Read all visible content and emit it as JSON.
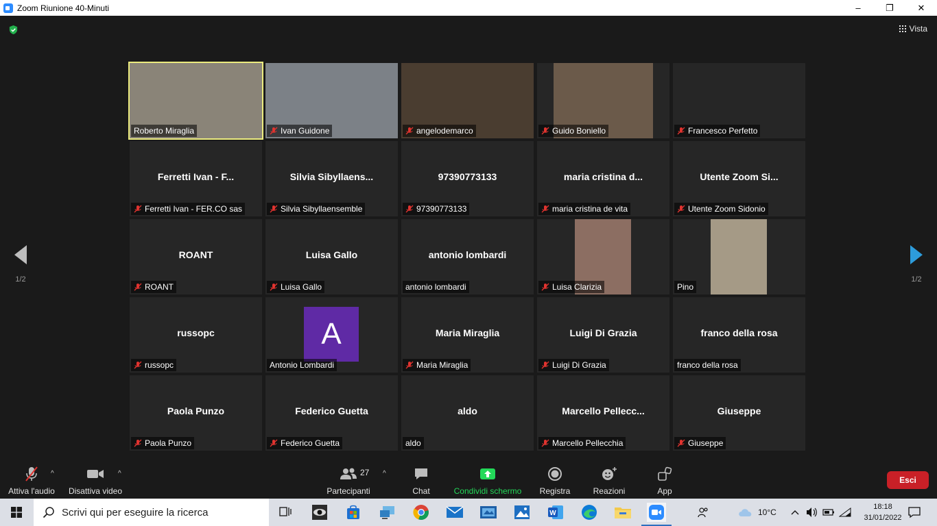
{
  "window": {
    "title": "Zoom Riunione 40-Minuti",
    "controls": {
      "minimize": "–",
      "restore": "❐",
      "close": "✕"
    }
  },
  "header": {
    "view_label": "Vista"
  },
  "pagination": {
    "left_page": "1/2",
    "right_page": "1/2"
  },
  "participants": [
    {
      "big_name": "",
      "label": "Roberto Miraglia",
      "muted": false,
      "video": "full",
      "bg": "#8a8478",
      "active": true
    },
    {
      "big_name": "",
      "label": "Ivan Guidone",
      "muted": true,
      "video": "full",
      "bg": "#7c8187"
    },
    {
      "big_name": "",
      "label": "angelodemarco",
      "muted": true,
      "video": "full",
      "bg": "#4a3d30"
    },
    {
      "big_name": "",
      "label": "Guido Boniello",
      "muted": true,
      "video": "mid",
      "bg": "#6b5a4a"
    },
    {
      "big_name": "",
      "label": "Francesco Perfetto",
      "muted": true,
      "video": "none"
    },
    {
      "big_name": "Ferretti Ivan - F...",
      "label": "Ferretti Ivan - FER.CO sas",
      "muted": true,
      "video": "none"
    },
    {
      "big_name": "Silvia  Sibyllaens...",
      "label": "Silvia Sibyllaensemble",
      "muted": true,
      "video": "none"
    },
    {
      "big_name": "97390773133",
      "label": "97390773133",
      "muted": true,
      "video": "none"
    },
    {
      "big_name": "maria cristina d...",
      "label": "maria cristina de vita",
      "muted": true,
      "video": "none"
    },
    {
      "big_name": "Utente Zoom Si...",
      "label": "Utente Zoom Sidonio",
      "muted": true,
      "video": "none"
    },
    {
      "big_name": "ROANT",
      "label": "ROANT",
      "muted": true,
      "video": "none"
    },
    {
      "big_name": "Luisa Gallo",
      "label": "Luisa Gallo",
      "muted": true,
      "video": "none"
    },
    {
      "big_name": "antonio lombardi",
      "label": "antonio lombardi",
      "muted": false,
      "video": "none"
    },
    {
      "big_name": "",
      "label": "Luisa Clarizia",
      "muted": true,
      "video": "narrow",
      "bg": "#8c6e62"
    },
    {
      "big_name": "",
      "label": "Pino",
      "muted": false,
      "video": "narrow",
      "bg": "#a59a86"
    },
    {
      "big_name": "russopc",
      "label": "russopc",
      "muted": true,
      "video": "none"
    },
    {
      "big_name": "",
      "label": "Antonio Lombardi",
      "muted": false,
      "video": "avatar",
      "avatar_letter": "A"
    },
    {
      "big_name": "Maria Miraglia",
      "label": "Maria Miraglia",
      "muted": true,
      "video": "none"
    },
    {
      "big_name": "Luigi Di Grazia",
      "label": "Luigi Di Grazia",
      "muted": true,
      "video": "none"
    },
    {
      "big_name": "franco  della rosa",
      "label": "franco  della rosa",
      "muted": false,
      "video": "none"
    },
    {
      "big_name": "Paola Punzo",
      "label": "Paola Punzo",
      "muted": true,
      "video": "none"
    },
    {
      "big_name": "Federico Guetta",
      "label": "Federico Guetta",
      "muted": true,
      "video": "none"
    },
    {
      "big_name": "aldo",
      "label": "aldo",
      "muted": false,
      "video": "none"
    },
    {
      "big_name": "Marcello  Pellecc...",
      "label": "Marcello Pellecchia",
      "muted": true,
      "video": "none"
    },
    {
      "big_name": "Giuseppe",
      "label": "Giuseppe",
      "muted": true,
      "video": "none"
    }
  ],
  "toolbar": {
    "audio_label": "Attiva l'audio",
    "video_label": "Disattiva video",
    "participants_label": "Partecipanti",
    "participants_count": "27",
    "chat_label": "Chat",
    "share_label": "Condividi schermo",
    "record_label": "Registra",
    "reactions_label": "Reazioni",
    "apps_label": "App",
    "leave_label": "Esci",
    "share_color": "#23d959",
    "leave_color": "#c92027"
  },
  "taskbar": {
    "search_placeholder": "Scrivi qui per eseguire la ricerca",
    "weather_temp": "10°C",
    "time": "18:18",
    "date": "31/01/2022"
  }
}
